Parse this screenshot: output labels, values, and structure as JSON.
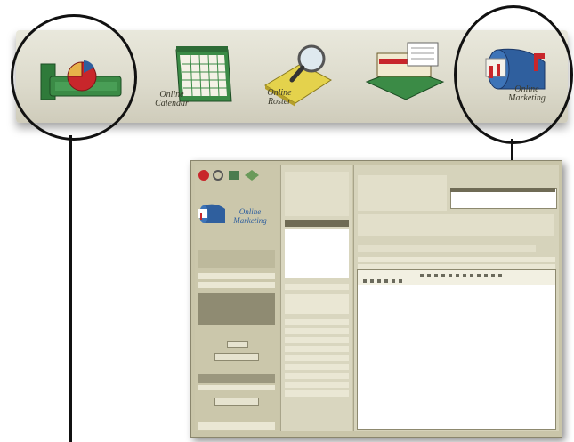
{
  "toolbar": {
    "items": [
      {
        "label": "",
        "icon": "statistics-chart-icon"
      },
      {
        "label": "Online Calendar",
        "icon": "calendar-icon"
      },
      {
        "label": "Online Roster",
        "icon": "magnifier-roster-icon"
      },
      {
        "label": "",
        "icon": "property-listing-icon"
      },
      {
        "label": "Online Marketing",
        "icon": "mailbox-icon"
      }
    ]
  },
  "inner_app": {
    "brand_label": "Online Marketing",
    "icons": [
      "globe-icon",
      "search-icon",
      "rss-icon",
      "arrows-icon"
    ]
  },
  "colors": {
    "toolbar": "#dcdacb",
    "outline": "#111111",
    "panel": "#c9c5a9",
    "mailbox_blue": "#2f5f9e",
    "mailbox_red": "#c8262b"
  }
}
